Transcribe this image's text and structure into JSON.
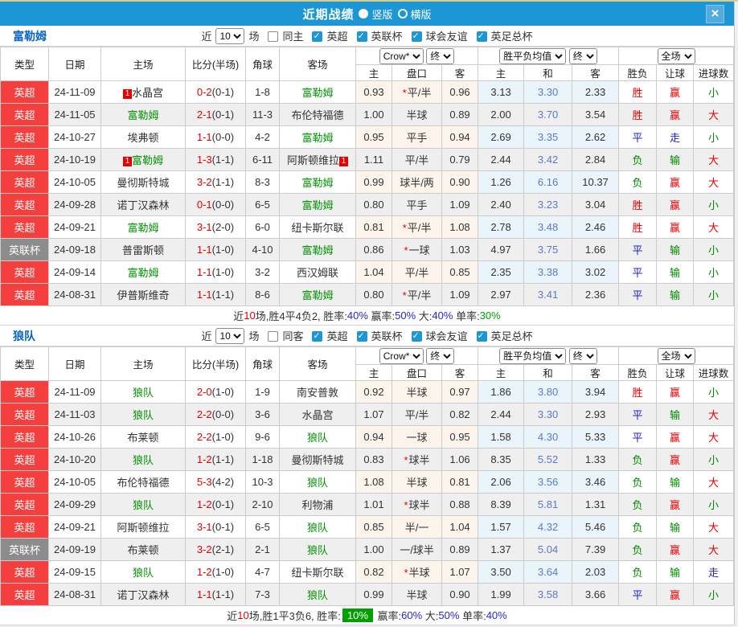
{
  "colors": {
    "accent": "#1d96d5",
    "blue_label": "#0a63c9",
    "red_badge": "#f53e3e",
    "gray_badge": "#8c8c8c",
    "team_green": "#009400",
    "score_red": "#e60000",
    "res_win": "#e60000",
    "res_draw": "#1f1fd9",
    "res_lose": "#008800",
    "avg_mid": "#5b79c9",
    "odds_bg": "#fdf5ec",
    "avg_bg": "#eaf4fb",
    "pct_blue": "#2424e0",
    "pct_green": "#00a000"
  },
  "titlebar": {
    "title": "近期战绩",
    "radios": [
      {
        "label": "竖版",
        "selected": true
      },
      {
        "label": "横版",
        "selected": false
      }
    ],
    "close_label": "×"
  },
  "filters": {
    "near": "近",
    "count": "10",
    "games": "场",
    "leagues": [
      "英超",
      "英联杯",
      "球会友谊",
      "英足总杯"
    ]
  },
  "header": {
    "cols": [
      "类型",
      "日期",
      "主场",
      "比分(半场)",
      "角球",
      "客场"
    ],
    "odds_source": "Crow*",
    "odds_scope": "终",
    "avg_source": "胜平负均值",
    "avg_scope": "终",
    "result_scope": "全场",
    "sub": [
      "主",
      "盘口",
      "客",
      "主",
      "和",
      "客",
      "胜负",
      "让球",
      "进球数"
    ]
  },
  "result_color_map": {
    "胜": "win",
    "赢": "win",
    "大": "win",
    "平": "draw",
    "走": "draw",
    "负": "lose",
    "输": "lose",
    "小": "lose"
  },
  "sections": [
    {
      "team": "富勒姆",
      "same_label": "同主",
      "rows": [
        {
          "comp": "英超",
          "cup": false,
          "date": "24-11-09",
          "home": "水晶宫",
          "hg": false,
          "hb": "1",
          "score": "0-2",
          "half": "(0-1)",
          "corner": "1-8",
          "away": "富勒姆",
          "ag": true,
          "ab": "",
          "o1": "0.93",
          "star": true,
          "hcp": "平/半",
          "o2": "0.96",
          "a1": "3.13",
          "a2": "3.30",
          "a3": "2.33",
          "r1": "胜",
          "r2": "赢",
          "r3": "小"
        },
        {
          "comp": "英超",
          "cup": false,
          "date": "24-11-05",
          "home": "富勒姆",
          "hg": true,
          "hb": "",
          "score": "2-1",
          "half": "(0-1)",
          "corner": "11-3",
          "away": "布伦特福德",
          "ag": false,
          "ab": "",
          "o1": "1.00",
          "star": false,
          "hcp": "半球",
          "o2": "0.89",
          "a1": "2.00",
          "a2": "3.70",
          "a3": "3.54",
          "r1": "胜",
          "r2": "赢",
          "r3": "大"
        },
        {
          "comp": "英超",
          "cup": false,
          "date": "24-10-27",
          "home": "埃弗顿",
          "hg": false,
          "hb": "",
          "score": "1-1",
          "half": "(0-0)",
          "corner": "4-2",
          "away": "富勒姆",
          "ag": true,
          "ab": "",
          "o1": "0.95",
          "star": false,
          "hcp": "平手",
          "o2": "0.94",
          "a1": "2.69",
          "a2": "3.35",
          "a3": "2.62",
          "r1": "平",
          "r2": "走",
          "r3": "小"
        },
        {
          "comp": "英超",
          "cup": false,
          "date": "24-10-19",
          "home": "富勒姆",
          "hg": true,
          "hb": "1",
          "score": "1-3",
          "half": "(1-1)",
          "corner": "6-11",
          "away": "阿斯顿维拉",
          "ag": false,
          "ab": "1",
          "o1": "1.11",
          "star": false,
          "hcp": "平/半",
          "o2": "0.79",
          "a1": "2.44",
          "a2": "3.42",
          "a3": "2.84",
          "r1": "负",
          "r2": "输",
          "r3": "大"
        },
        {
          "comp": "英超",
          "cup": false,
          "date": "24-10-05",
          "home": "曼彻斯特城",
          "hg": false,
          "hb": "",
          "score": "3-2",
          "half": "(1-1)",
          "corner": "8-3",
          "away": "富勒姆",
          "ag": true,
          "ab": "",
          "o1": "0.99",
          "star": false,
          "hcp": "球半/两",
          "o2": "0.90",
          "a1": "1.26",
          "a2": "6.16",
          "a3": "10.37",
          "r1": "负",
          "r2": "赢",
          "r3": "大"
        },
        {
          "comp": "英超",
          "cup": false,
          "date": "24-09-28",
          "home": "诺丁汉森林",
          "hg": false,
          "hb": "",
          "score": "0-1",
          "half": "(0-0)",
          "corner": "6-5",
          "away": "富勒姆",
          "ag": true,
          "ab": "",
          "o1": "0.80",
          "star": false,
          "hcp": "平手",
          "o2": "1.09",
          "a1": "2.40",
          "a2": "3.23",
          "a3": "3.04",
          "r1": "胜",
          "r2": "赢",
          "r3": "小"
        },
        {
          "comp": "英超",
          "cup": false,
          "date": "24-09-21",
          "home": "富勒姆",
          "hg": true,
          "hb": "",
          "score": "3-1",
          "half": "(2-0)",
          "corner": "6-0",
          "away": "纽卡斯尔联",
          "ag": false,
          "ab": "",
          "o1": "0.81",
          "star": true,
          "hcp": "平/半",
          "o2": "1.08",
          "a1": "2.78",
          "a2": "3.48",
          "a3": "2.46",
          "r1": "胜",
          "r2": "赢",
          "r3": "大"
        },
        {
          "comp": "英联杯",
          "cup": true,
          "date": "24-09-18",
          "home": "普雷斯顿",
          "hg": false,
          "hb": "",
          "score": "1-1",
          "half": "(1-0)",
          "corner": "4-10",
          "away": "富勒姆",
          "ag": true,
          "ab": "",
          "o1": "0.86",
          "star": true,
          "hcp": "一球",
          "o2": "1.03",
          "a1": "4.97",
          "a2": "3.75",
          "a3": "1.66",
          "r1": "平",
          "r2": "输",
          "r3": "小"
        },
        {
          "comp": "英超",
          "cup": false,
          "date": "24-09-14",
          "home": "富勒姆",
          "hg": true,
          "hb": "",
          "score": "1-1",
          "half": "(1-0)",
          "corner": "3-2",
          "away": "西汉姆联",
          "ag": false,
          "ab": "",
          "o1": "1.04",
          "star": false,
          "hcp": "平/半",
          "o2": "0.85",
          "a1": "2.35",
          "a2": "3.38",
          "a3": "3.02",
          "r1": "平",
          "r2": "输",
          "r3": "小"
        },
        {
          "comp": "英超",
          "cup": false,
          "date": "24-08-31",
          "home": "伊普斯维奇",
          "hg": false,
          "hb": "",
          "score": "1-1",
          "half": "(1-1)",
          "corner": "8-6",
          "away": "富勒姆",
          "ag": true,
          "ab": "",
          "o1": "0.80",
          "star": true,
          "hcp": "平/半",
          "o2": "1.09",
          "a1": "2.97",
          "a2": "3.41",
          "a3": "2.36",
          "r1": "平",
          "r2": "输",
          "r3": "小"
        }
      ],
      "summary": [
        [
          "近",
          ""
        ],
        [
          "10",
          "red"
        ],
        [
          "场,胜4平4负2, 胜率:",
          ""
        ],
        [
          "40%",
          "blue"
        ],
        [
          " 赢率:",
          ""
        ],
        [
          "50%",
          "blue"
        ],
        [
          " 大:",
          ""
        ],
        [
          "40%",
          "blue"
        ],
        [
          " 单率:",
          ""
        ],
        [
          "30%",
          "green"
        ]
      ]
    },
    {
      "team": "狼队",
      "same_label": "同客",
      "rows": [
        {
          "comp": "英超",
          "cup": false,
          "date": "24-11-09",
          "home": "狼队",
          "hg": true,
          "hb": "",
          "score": "2-0",
          "half": "(1-0)",
          "corner": "1-9",
          "away": "南安普敦",
          "ag": false,
          "ab": "",
          "o1": "0.92",
          "star": false,
          "hcp": "半球",
          "o2": "0.97",
          "a1": "1.86",
          "a2": "3.80",
          "a3": "3.94",
          "r1": "胜",
          "r2": "赢",
          "r3": "小"
        },
        {
          "comp": "英超",
          "cup": false,
          "date": "24-11-03",
          "home": "狼队",
          "hg": true,
          "hb": "",
          "score": "2-2",
          "half": "(0-0)",
          "corner": "3-6",
          "away": "水晶宫",
          "ag": false,
          "ab": "",
          "o1": "1.07",
          "star": false,
          "hcp": "平/半",
          "o2": "0.82",
          "a1": "2.44",
          "a2": "3.30",
          "a3": "2.93",
          "r1": "平",
          "r2": "输",
          "r3": "大"
        },
        {
          "comp": "英超",
          "cup": false,
          "date": "24-10-26",
          "home": "布莱顿",
          "hg": false,
          "hb": "",
          "score": "2-2",
          "half": "(1-0)",
          "corner": "9-6",
          "away": "狼队",
          "ag": true,
          "ab": "",
          "o1": "0.94",
          "star": false,
          "hcp": "一球",
          "o2": "0.95",
          "a1": "1.58",
          "a2": "4.30",
          "a3": "5.33",
          "r1": "平",
          "r2": "赢",
          "r3": "大"
        },
        {
          "comp": "英超",
          "cup": false,
          "date": "24-10-20",
          "home": "狼队",
          "hg": true,
          "hb": "",
          "score": "1-2",
          "half": "(1-1)",
          "corner": "1-18",
          "away": "曼彻斯特城",
          "ag": false,
          "ab": "",
          "o1": "0.83",
          "star": true,
          "hcp": "球半",
          "o2": "1.06",
          "a1": "8.35",
          "a2": "5.52",
          "a3": "1.33",
          "r1": "负",
          "r2": "赢",
          "r3": "小"
        },
        {
          "comp": "英超",
          "cup": false,
          "date": "24-10-05",
          "home": "布伦特福德",
          "hg": false,
          "hb": "",
          "score": "5-3",
          "half": "(4-2)",
          "corner": "10-3",
          "away": "狼队",
          "ag": true,
          "ab": "",
          "o1": "1.08",
          "star": false,
          "hcp": "半球",
          "o2": "0.81",
          "a1": "2.06",
          "a2": "3.56",
          "a3": "3.46",
          "r1": "负",
          "r2": "输",
          "r3": "大"
        },
        {
          "comp": "英超",
          "cup": false,
          "date": "24-09-29",
          "home": "狼队",
          "hg": true,
          "hb": "",
          "score": "1-2",
          "half": "(0-1)",
          "corner": "2-10",
          "away": "利物浦",
          "ag": false,
          "ab": "",
          "o1": "1.01",
          "star": true,
          "hcp": "球半",
          "o2": "0.88",
          "a1": "8.39",
          "a2": "5.81",
          "a3": "1.31",
          "r1": "负",
          "r2": "赢",
          "r3": "小"
        },
        {
          "comp": "英超",
          "cup": false,
          "date": "24-09-21",
          "home": "阿斯顿维拉",
          "hg": false,
          "hb": "",
          "score": "3-1",
          "half": "(0-1)",
          "corner": "6-5",
          "away": "狼队",
          "ag": true,
          "ab": "",
          "o1": "0.85",
          "star": false,
          "hcp": "半/一",
          "o2": "1.04",
          "a1": "1.57",
          "a2": "4.32",
          "a3": "5.46",
          "r1": "负",
          "r2": "输",
          "r3": "大"
        },
        {
          "comp": "英联杯",
          "cup": true,
          "date": "24-09-19",
          "home": "布莱顿",
          "hg": false,
          "hb": "",
          "score": "3-2",
          "half": "(2-1)",
          "corner": "2-1",
          "away": "狼队",
          "ag": true,
          "ab": "",
          "o1": "1.00",
          "star": false,
          "hcp": "一/球半",
          "o2": "0.89",
          "a1": "1.37",
          "a2": "5.04",
          "a3": "7.39",
          "r1": "负",
          "r2": "赢",
          "r3": "大"
        },
        {
          "comp": "英超",
          "cup": false,
          "date": "24-09-15",
          "home": "狼队",
          "hg": true,
          "hb": "",
          "score": "1-2",
          "half": "(1-0)",
          "corner": "4-7",
          "away": "纽卡斯尔联",
          "ag": false,
          "ab": "",
          "o1": "0.82",
          "star": true,
          "hcp": "半球",
          "o2": "1.07",
          "a1": "3.50",
          "a2": "3.64",
          "a3": "2.03",
          "r1": "负",
          "r2": "输",
          "r3": "走"
        },
        {
          "comp": "英超",
          "cup": false,
          "date": "24-08-31",
          "home": "诺丁汉森林",
          "hg": false,
          "hb": "",
          "score": "1-1",
          "half": "(1-1)",
          "corner": "7-3",
          "away": "狼队",
          "ag": true,
          "ab": "",
          "o1": "0.99",
          "star": false,
          "hcp": "半球",
          "o2": "0.90",
          "a1": "1.99",
          "a2": "3.58",
          "a3": "3.66",
          "r1": "平",
          "r2": "赢",
          "r3": "小"
        }
      ],
      "summary": [
        [
          "近",
          ""
        ],
        [
          "10",
          "red"
        ],
        [
          "场,胜1平3负6, 胜率:",
          ""
        ],
        [
          "10%",
          "badge"
        ],
        [
          " 赢率:",
          ""
        ],
        [
          "60%",
          "blue"
        ],
        [
          " 大:",
          ""
        ],
        [
          "50%",
          "blue"
        ],
        [
          " 单率:",
          ""
        ],
        [
          "40%",
          "blue"
        ]
      ]
    }
  ]
}
